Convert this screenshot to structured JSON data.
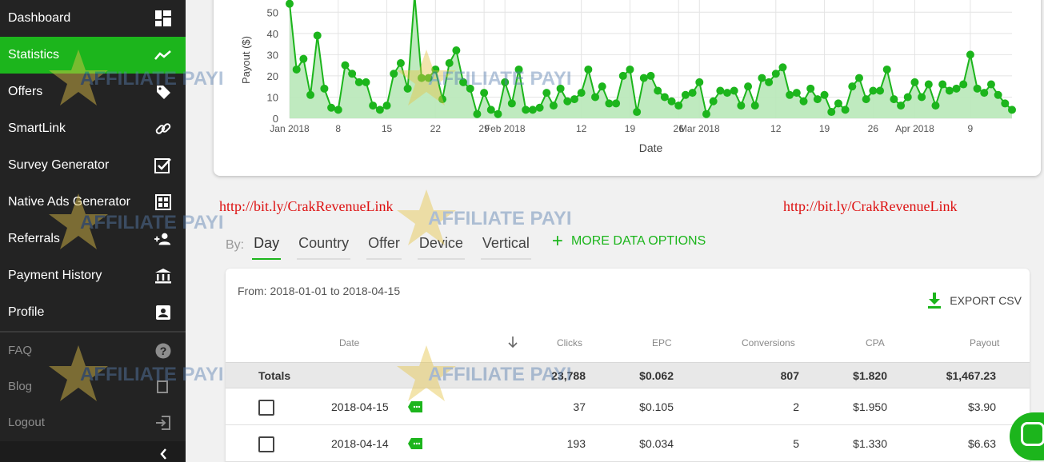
{
  "sidebar": {
    "items": [
      {
        "label": "Dashboard",
        "icon": "dashboard-icon",
        "active": false
      },
      {
        "label": "Statistics",
        "icon": "trending-icon",
        "active": true
      },
      {
        "label": "Offers",
        "icon": "tag-icon",
        "active": false
      },
      {
        "label": "SmartLink",
        "icon": "link-icon",
        "active": false
      },
      {
        "label": "Survey Generator",
        "icon": "checkbox-icon",
        "active": false
      },
      {
        "label": "Native Ads Generator",
        "icon": "grid-icon",
        "active": false
      },
      {
        "label": "Referrals",
        "icon": "group-add-icon",
        "active": false
      },
      {
        "label": "Payment History",
        "icon": "bank-icon",
        "active": false
      },
      {
        "label": "Profile",
        "icon": "id-card-icon",
        "active": false
      }
    ],
    "secondary": [
      {
        "label": "FAQ",
        "icon": "help-icon"
      },
      {
        "label": "Blog",
        "icon": "blog-icon"
      },
      {
        "label": "Logout",
        "icon": "logout-icon"
      }
    ]
  },
  "watermark": "AFFILIATE PAYING",
  "colors": {
    "accent": "#1cb51c",
    "sidebar": "#232323",
    "link": "#dd1111"
  },
  "chart_data": {
    "type": "area",
    "ylabel": "Payout ($)",
    "xlabel": "Date",
    "ylim": [
      0,
      55
    ],
    "yticks": [
      0,
      10,
      20,
      30,
      40,
      50
    ],
    "xlim": [
      "2018-01-01",
      "2018-04-15"
    ],
    "xticks": [
      {
        "date": "2018-01-01",
        "label": "Jan 2018"
      },
      {
        "date": "2018-01-08",
        "label": "8"
      },
      {
        "date": "2018-01-15",
        "label": "15"
      },
      {
        "date": "2018-01-22",
        "label": "22"
      },
      {
        "date": "2018-01-29",
        "label": "29"
      },
      {
        "date": "2018-02-01",
        "label": "Feb 2018"
      },
      {
        "date": "2018-02-12",
        "label": "12"
      },
      {
        "date": "2018-02-19",
        "label": "19"
      },
      {
        "date": "2018-02-26",
        "label": "26"
      },
      {
        "date": "2018-03-01",
        "label": "Mar 2018"
      },
      {
        "date": "2018-03-12",
        "label": "12"
      },
      {
        "date": "2018-03-19",
        "label": "19"
      },
      {
        "date": "2018-03-26",
        "label": "26"
      },
      {
        "date": "2018-04-01",
        "label": "Apr 2018"
      },
      {
        "date": "2018-04-09",
        "label": "9"
      }
    ],
    "grid": true,
    "series": [
      {
        "name": "",
        "start_date": "2018-01-01",
        "values": [
          54,
          23,
          28,
          11,
          39,
          14,
          5,
          4,
          25,
          21,
          17,
          17,
          6,
          4,
          6,
          21,
          26,
          14,
          58,
          19,
          19,
          23,
          9,
          26,
          32,
          17,
          14,
          2,
          12,
          4,
          2,
          17,
          7,
          23,
          4,
          4,
          5,
          12,
          6,
          14,
          8,
          9,
          12,
          23,
          10,
          15,
          7,
          7,
          20,
          23,
          3,
          19,
          20,
          13,
          10,
          8,
          6,
          11,
          12,
          17,
          2,
          8,
          13,
          12,
          13,
          6,
          15,
          6,
          19,
          17,
          21,
          24,
          11,
          12,
          8,
          14,
          9,
          11,
          3,
          7,
          4,
          15,
          19,
          9,
          13,
          13,
          23,
          9,
          6,
          10,
          17,
          10,
          16,
          6,
          16,
          13,
          14,
          16,
          30,
          14,
          12,
          16,
          11,
          7,
          4
        ]
      }
    ]
  },
  "links": {
    "left": "http://bit.ly/CrakRevenueLink",
    "right": "http://bit.ly/CrakRevenueLink"
  },
  "tabs": {
    "by_label": "By:",
    "items": [
      {
        "label": "Day",
        "active": true
      },
      {
        "label": "Country",
        "active": false
      },
      {
        "label": "Offer",
        "active": false
      },
      {
        "label": "Device",
        "active": false
      },
      {
        "label": "Vertical",
        "active": false
      }
    ],
    "more_label": "MORE DATA OPTIONS"
  },
  "table": {
    "range": "From: 2018-01-01 to 2018-04-15",
    "export_label": "EXPORT CSV",
    "headers": {
      "date": "Date",
      "clicks": "Clicks",
      "epc": "EPC",
      "conversions": "Conversions",
      "cpa": "CPA",
      "payout": "Payout"
    },
    "totals": {
      "label": "Totals",
      "clicks": "23,788",
      "epc": "$0.062",
      "conversions": "807",
      "cpa": "$1.820",
      "payout": "$1,467.23"
    },
    "rows": [
      {
        "date": "2018-04-15",
        "clicks": "37",
        "epc": "$0.105",
        "conversions": "2",
        "cpa": "$1.950",
        "payout": "$3.90"
      },
      {
        "date": "2018-04-14",
        "clicks": "193",
        "epc": "$0.034",
        "conversions": "5",
        "cpa": "$1.330",
        "payout": "$6.63"
      }
    ]
  }
}
